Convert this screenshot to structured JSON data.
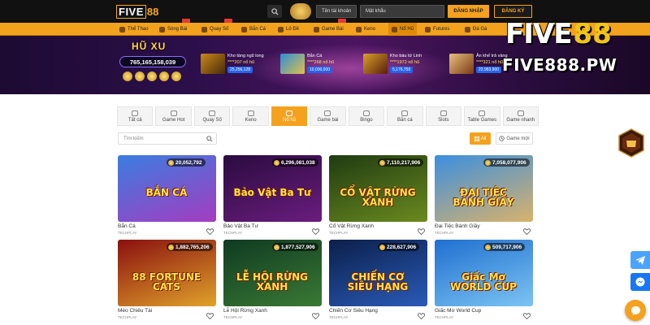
{
  "header": {
    "logo_five": "FIVE",
    "logo_88": "88",
    "username_placeholder": "Tên tài khoản",
    "password_placeholder": "Mật khẩu",
    "login_label": "ĐĂNG NHẬP",
    "register_label": "ĐĂNG KÝ"
  },
  "nav": {
    "items": [
      {
        "label": "Thể Thao"
      },
      {
        "label": "Sòng Bài"
      },
      {
        "label": "Quay Số"
      },
      {
        "label": "Bắn Cá"
      },
      {
        "label": "Lô Đề"
      },
      {
        "label": "Game Bài"
      },
      {
        "label": "Keno"
      },
      {
        "label": "Nổ Hũ"
      },
      {
        "label": "Futures"
      },
      {
        "label": "Đá Gà"
      }
    ],
    "active_index": 7
  },
  "banner": {
    "jackpot_label": "HŨ XU",
    "jackpot_value": "765,165,158,039",
    "cards": [
      {
        "name": "Kho tàng ngũ long",
        "amount": "****207 nổ hũ",
        "value": "25,256,128"
      },
      {
        "name": "Bắn Cá",
        "amount": "****268 nổ hũ",
        "value": "10,000,000"
      },
      {
        "name": "Kho báu tứ Linh",
        "amount": "****1972 nổ hũ",
        "value": "5,176,750"
      },
      {
        "name": "Ăn khế trả vàng",
        "amount": "****321 nổ hũ",
        "value": "22,983,900"
      }
    ]
  },
  "watermark": {
    "top_five": "FIVE",
    "top_88": "88",
    "bottom": "FIVE888.PW"
  },
  "categories": [
    {
      "label": "Tất cả",
      "icon": "grid-icon"
    },
    {
      "label": "Game Hot",
      "icon": "fire-icon"
    },
    {
      "label": "Quay Số",
      "icon": "lottery-icon"
    },
    {
      "label": "Keno",
      "icon": "keno-icon"
    },
    {
      "label": "Nổ hũ",
      "icon": "jackpot-icon"
    },
    {
      "label": "Game bài",
      "icon": "cards-icon"
    },
    {
      "label": "Bingo",
      "icon": "bingo-icon"
    },
    {
      "label": "Bắn cá",
      "icon": "fish-icon"
    },
    {
      "label": "Slots",
      "icon": "slot-icon"
    },
    {
      "label": "Table Games",
      "icon": "table-icon"
    },
    {
      "label": "Game nhanh",
      "icon": "fast-icon"
    }
  ],
  "active_category": 4,
  "filter": {
    "search_placeholder": "Tìm kiếm",
    "all_label": "All",
    "new_label": "Game mới"
  },
  "games": [
    {
      "name": "Bắn Cá",
      "provider": "TECHPLAY",
      "jackpot": "20,052,792",
      "art": "BẮN CÁ",
      "bg1": "#3b7de0",
      "bg2": "#a43cc0"
    },
    {
      "name": "Bảo Vật Ba Tư",
      "provider": "TECHPLAY",
      "jackpot": "6,296,081,038",
      "art": "Bảo Vật Ba Tư",
      "bg1": "#2b0b3f",
      "bg2": "#6a1d7e"
    },
    {
      "name": "Cổ Vật Rừng Xanh",
      "provider": "TECHPLAY",
      "jackpot": "7,110,217,906",
      "art": "CỔ VẬT RỪNG XANH",
      "bg1": "#1f3b12",
      "bg2": "#6b8a1f"
    },
    {
      "name": "Đại Tiệc Bánh Giầy",
      "provider": "TECHPLAY",
      "jackpot": "7,058,077,906",
      "art": "ĐẠI TIỆC BÁNH GIẦY",
      "bg1": "#3a8fe0",
      "bg2": "#d9b26b"
    },
    {
      "name": "Mèo Chiêu Tài",
      "provider": "TECHPLAY",
      "jackpot": "1,882,765,206",
      "art": "88 FORTUNE CATS",
      "bg1": "#8a0f0f",
      "bg2": "#e0a22a"
    },
    {
      "name": "Lễ Hội Rừng Xanh",
      "provider": "TECHPLAY",
      "jackpot": "1,877,527,906",
      "art": "LỄ HỘI RỪNG XANH",
      "bg1": "#0f3a22",
      "bg2": "#3a7a34"
    },
    {
      "name": "Chiến Cơ Siêu Hạng",
      "provider": "TECHPLAY",
      "jackpot": "228,627,906",
      "art": "CHIẾN CƠ SIÊU HẠNG",
      "bg1": "#0b1f4a",
      "bg2": "#2a5bb8"
    },
    {
      "name": "Giấc Mơ World Cup",
      "provider": "TECHPLAY",
      "jackpot": "509,717,906",
      "art": "Giấc Mơ WORLD CUP",
      "bg1": "#1f6fd0",
      "bg2": "#7cc4f2"
    }
  ],
  "colors": {
    "accent": "#f5a11e",
    "header_bg": "#111111",
    "nav_bg": "#f2a21c"
  }
}
